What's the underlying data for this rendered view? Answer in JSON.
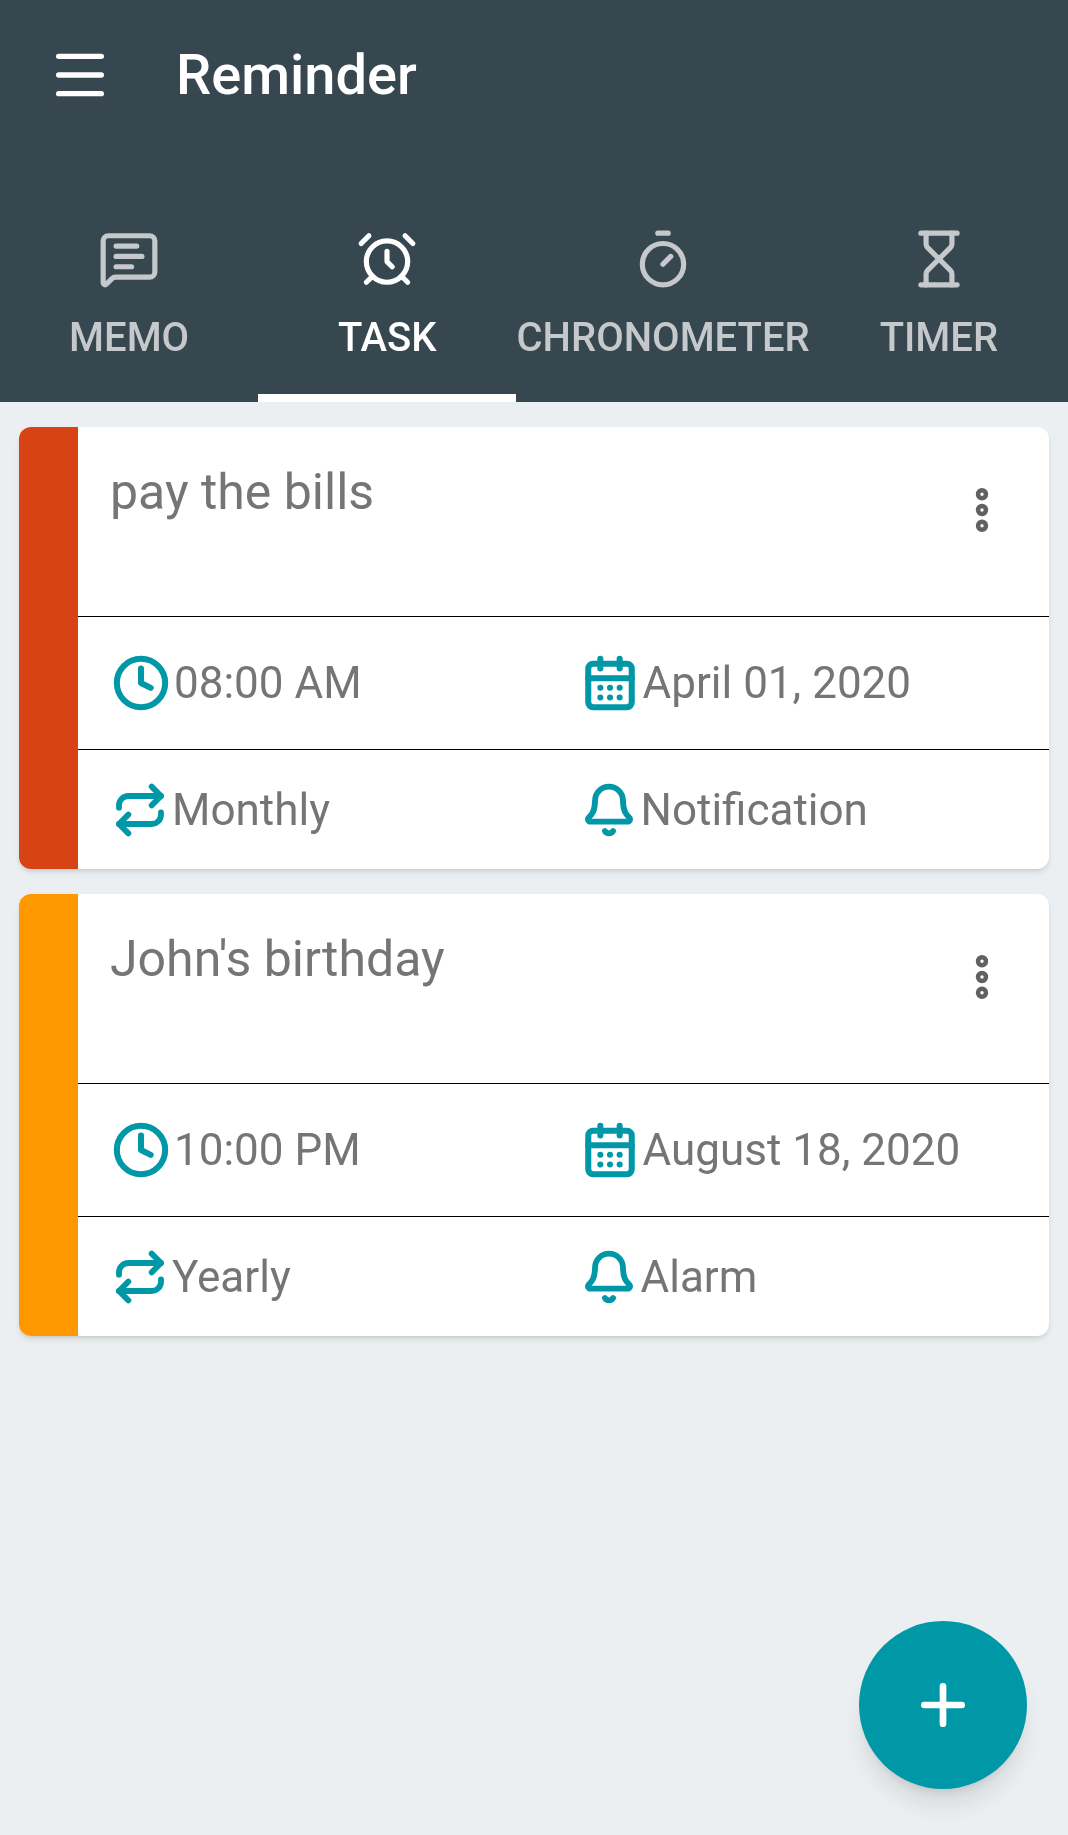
{
  "app_bar": {
    "title": "Reminder"
  },
  "tabs": [
    {
      "label": "MEMO",
      "kind": "memo",
      "selected": false
    },
    {
      "label": "TASK",
      "kind": "alarm",
      "selected": true
    },
    {
      "label": "CHRONOMETER",
      "kind": "stopwatch",
      "selected": false
    },
    {
      "label": "TIMER",
      "kind": "hourglass",
      "selected": false
    }
  ],
  "tasks": [
    {
      "title": "pay the bills",
      "color": "#d84315",
      "time": "08:00 AM",
      "date": "April 01, 2020",
      "repeat": "Monthly",
      "reminder": "Notification"
    },
    {
      "title": "John's birthday",
      "color": "#ff9800",
      "time": "10:00 PM",
      "date": "August 18, 2020",
      "repeat": "Yearly",
      "reminder": "Alarm"
    }
  ]
}
